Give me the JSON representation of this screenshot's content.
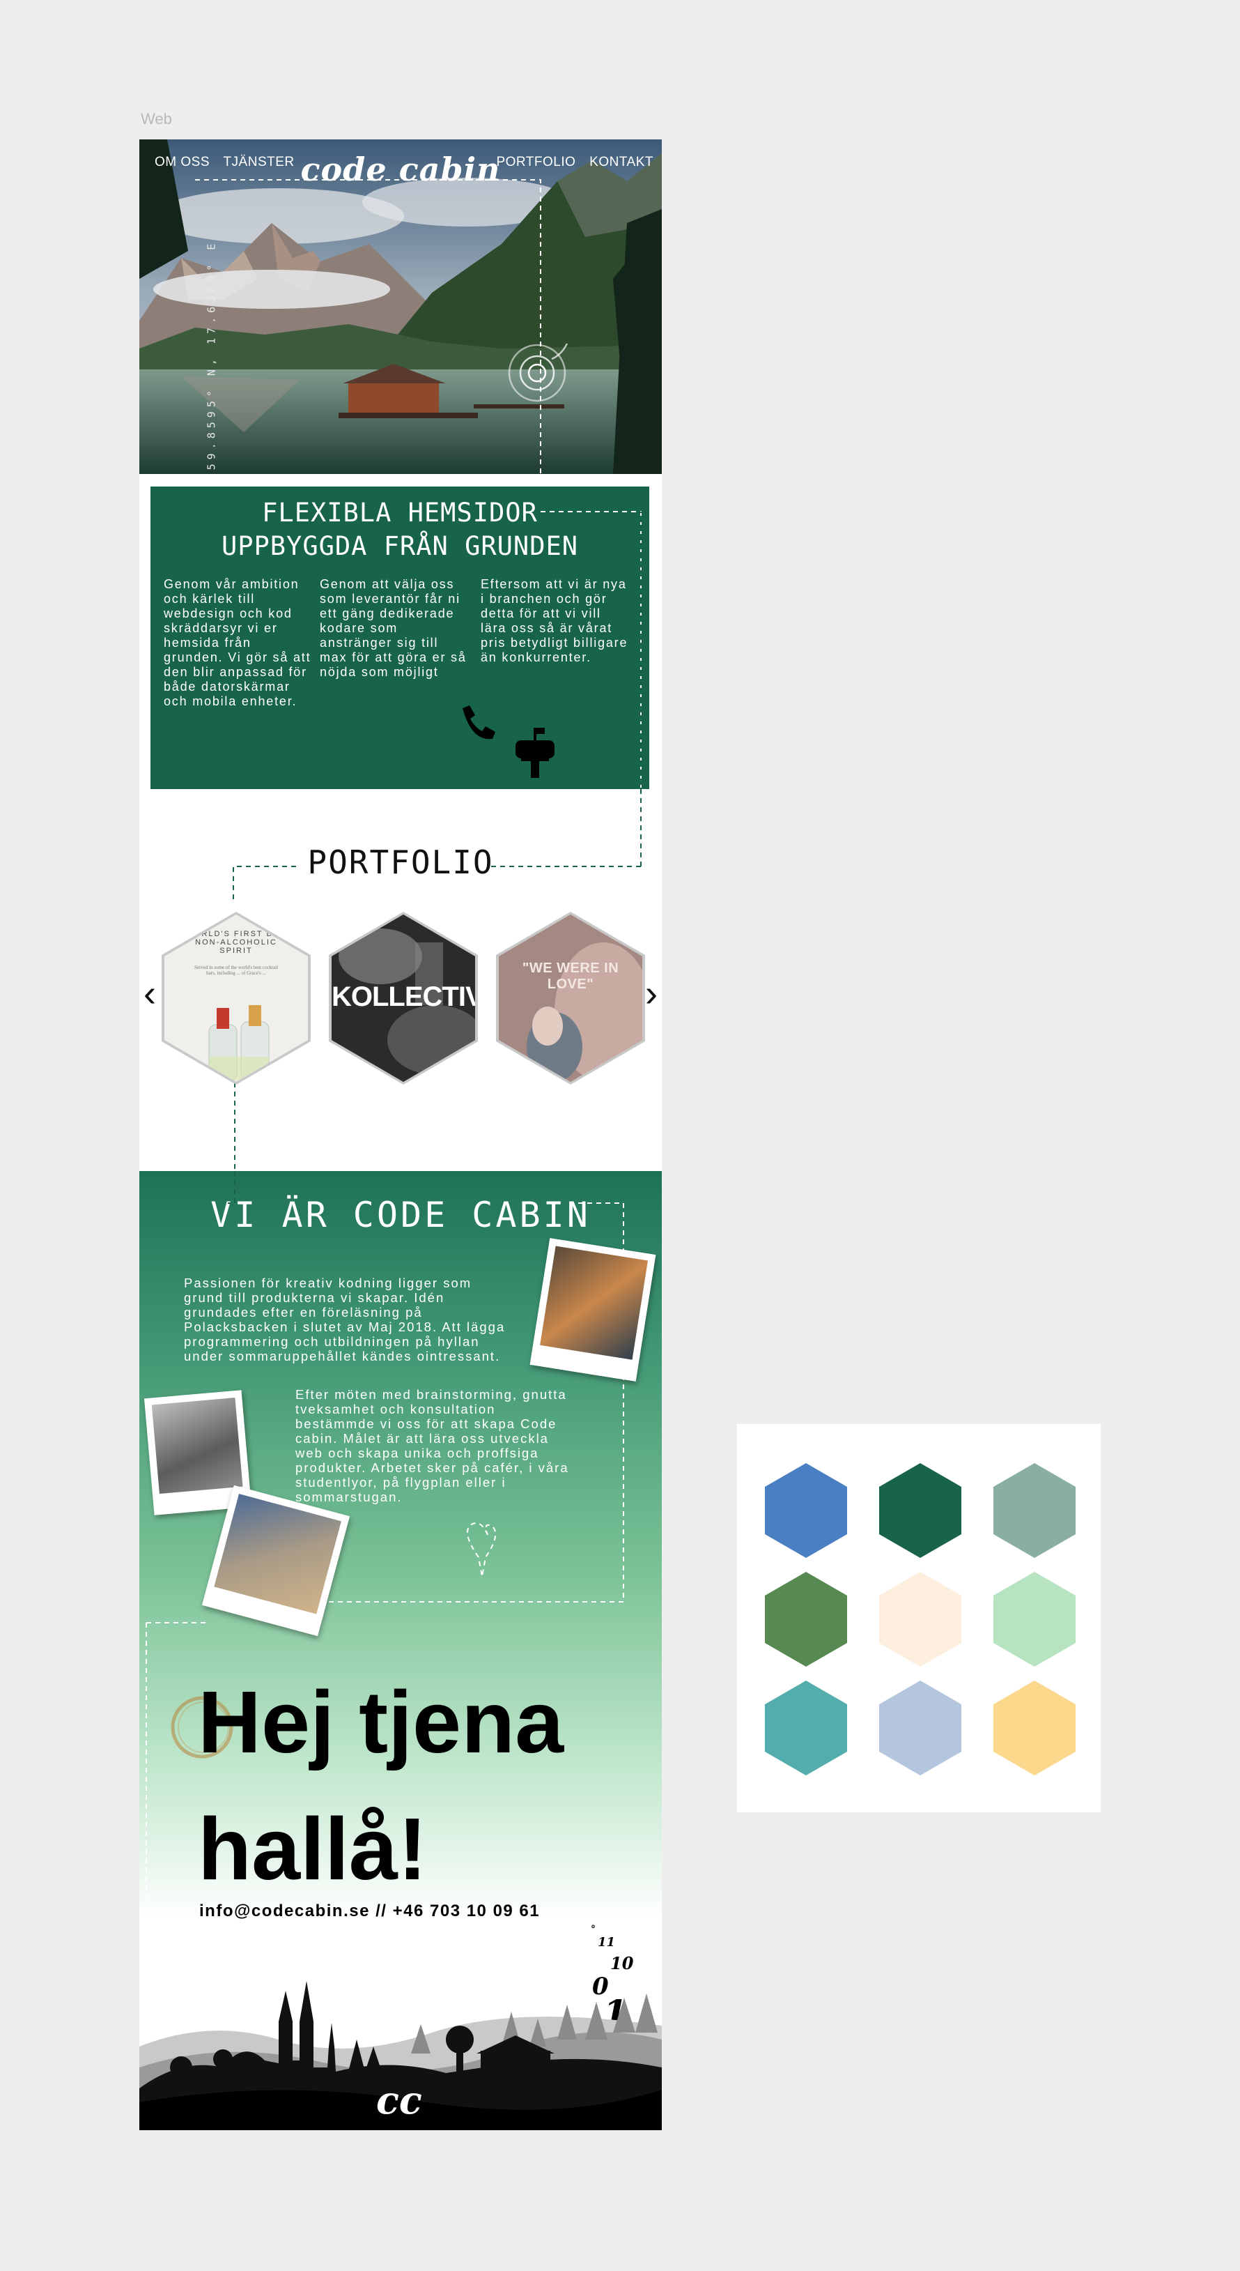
{
  "frame_label": "Web",
  "nav": {
    "left": [
      "OM OSS",
      "TJÄNSTER"
    ],
    "right": [
      "PORTFOLIO",
      "KONTAKT"
    ],
    "logo": "code cabin",
    "coordinates": "59.8595° N, 17.6389° E"
  },
  "info": {
    "title_line1": "FLEXIBLA HEMSIDOR",
    "title_line2": "UPPBYGGDA FRÅN GRUNDEN",
    "col1": "Genom vår ambition och kärlek till webdesign och kod skräddarsyr vi er hemsida från grunden. Vi gör så att den blir anpassad för både datorskärmar och mobila enheter.",
    "col2": "Genom att välja oss som leverantör får ni ett gäng dedikerade kodare som anstränger sig till max för att göra er så nöjda som möjligt",
    "col3": "Eftersom att vi är nya i branchen och gör detta för att vi vill lära oss så är vårat pris betydligt billigare än konkurrenter.",
    "icons": [
      "phone-icon",
      "mailbox-icon"
    ]
  },
  "portfolio": {
    "title": "PORTFOLIO",
    "items": [
      {
        "heading": "WORLD'S FIRST DRY NON-ALCOHOLIC SPIRIT",
        "subtext": "Served in some of the world's best cocktail bars, including ... of Grace's ..."
      },
      {
        "heading": "KOLLECTIV"
      },
      {
        "heading": "\"WE WERE IN LOVE\""
      }
    ],
    "prev": "‹",
    "next": "›"
  },
  "about": {
    "title": "VI ÄR CODE CABIN",
    "p1": "Passionen för kreativ kodning ligger som grund till produkterna vi skapar. Idén grundades efter en föreläsning på Polacksbacken i slutet av Maj 2018. Att lägga programmering och utbildningen på hyllan under sommaruppehållet kändes ointressant.",
    "p2": "Efter möten med brainstorming, gnutta tveksamhet och konsultation bestämmde vi oss för att skapa Code cabin. Målet är att lära oss utveckla web och skapa unika och proffsiga produkter. Arbetet sker på cafér, i våra studentlyor, på flygplan eller i sommarstugan.",
    "hej_line1": "Hej tjena",
    "hej_line2": "hallå!",
    "contact": "info@codecabin.se // +46 703 10 09 61",
    "binary": [
      "°",
      "11",
      "10",
      "0",
      "1"
    ],
    "footer_logo": "cc"
  },
  "palette": {
    "colors": [
      "#4a80c3",
      "#17634c",
      "#8aaea4",
      "#568a52",
      "#fdeedd",
      "#b8e3c1",
      "#54adad",
      "#b4c6dd",
      "#fbd88c"
    ]
  }
}
